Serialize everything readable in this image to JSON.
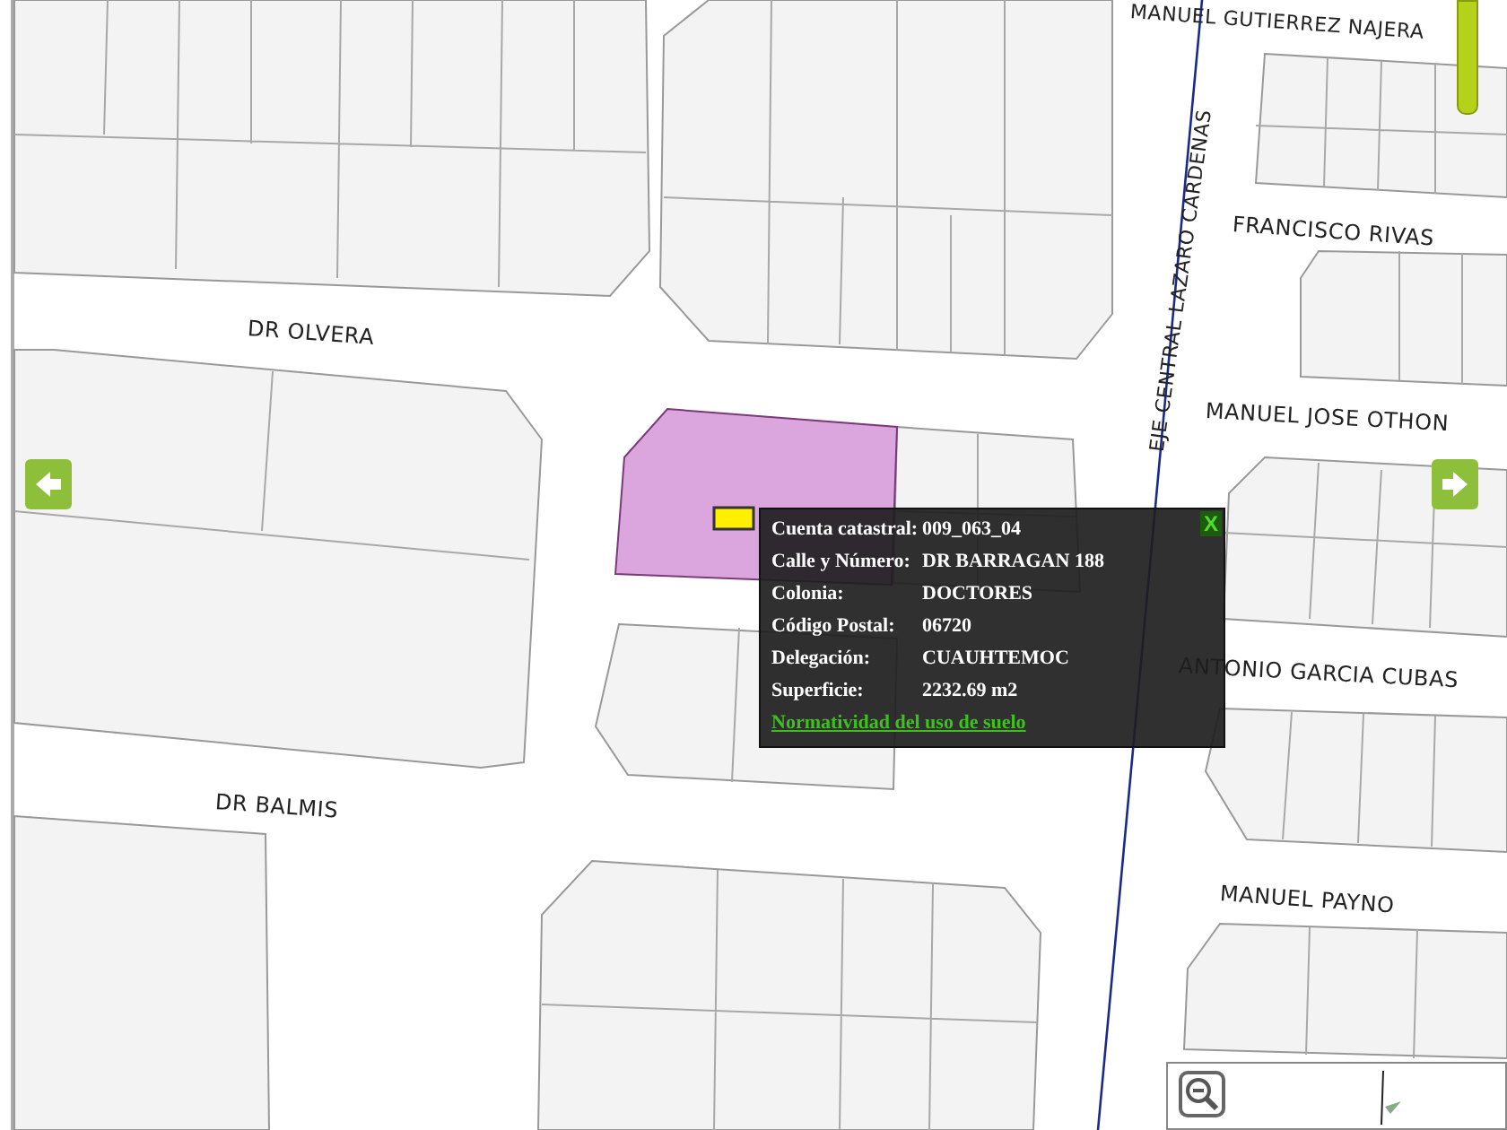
{
  "map": {
    "streets": [
      {
        "label": "MANUEL GUTIERREZ NAJERA"
      },
      {
        "label": "FRANCISCO RIVAS"
      },
      {
        "label": "DR OLVERA"
      },
      {
        "label": "EJE CENTRAL LAZARO CARDENAS"
      },
      {
        "label": "MANUEL JOSE OTHON"
      },
      {
        "label": "ANTONIO GARCIA CUBAS"
      },
      {
        "label": "DR BALMIS"
      },
      {
        "label": "MANUEL PAYNO"
      }
    ],
    "parcel": {
      "selected": true
    }
  },
  "popup": {
    "close": "X",
    "rows": [
      {
        "label": "Cuenta catastral:",
        "value": "009_063_04"
      },
      {
        "label": "Calle y Número:",
        "value": "DR BARRAGAN 188"
      },
      {
        "label": "Colonia:",
        "value": "DOCTORES"
      },
      {
        "label": "Código Postal:",
        "value": "06720"
      },
      {
        "label": "Delegación:",
        "value": "CUAUHTEMOC"
      },
      {
        "label": "Superficie:",
        "value": "2232.69 m2"
      }
    ],
    "link": "Normatividad del uso de suelo"
  }
}
